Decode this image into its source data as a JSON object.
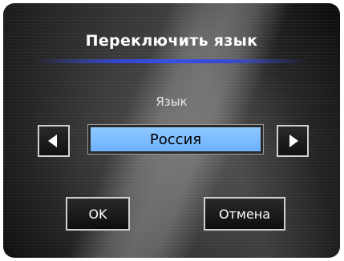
{
  "dialog": {
    "title": "Переключить язык",
    "language_label": "Язык",
    "selected_language": "Россия",
    "ok_label": "OK",
    "cancel_label": "Отмена"
  },
  "icons": {
    "prev": "triangle-left-icon",
    "next": "triangle-right-icon"
  },
  "colors": {
    "field_background": "#6eb1ff",
    "underline_accent": "#3a4fe6"
  }
}
